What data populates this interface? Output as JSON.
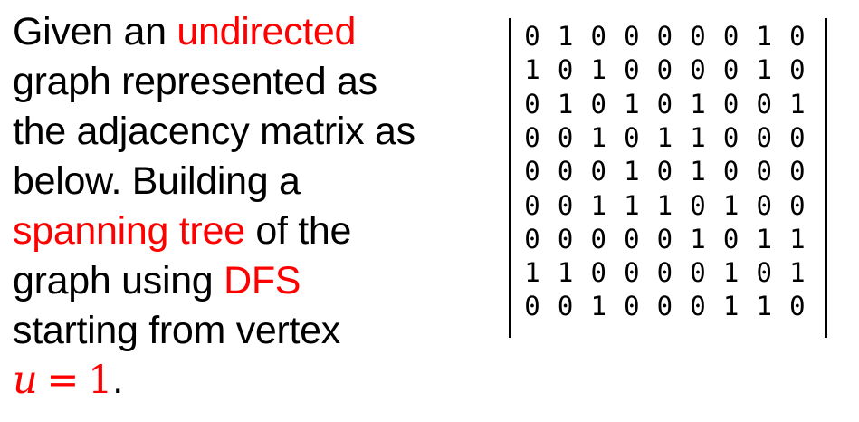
{
  "prose": {
    "l1_pre": "Given an ",
    "l1_red": "undirected",
    "l2": "graph represented as",
    "l3": "the adjacency matrix as",
    "l4": "below. Building a",
    "l5_red": "spanning tree",
    "l5_post": " of the",
    "l6_pre": "graph using ",
    "l6_red": "DFS",
    "l7": "starting from vertex",
    "math_var": "u",
    "math_eq": "=",
    "math_val": "1",
    "math_period": "."
  },
  "colors": {
    "text": "#000000",
    "highlight": "#ff0000",
    "background": "#ffffff"
  },
  "matrix": [
    [
      0,
      1,
      0,
      0,
      0,
      0,
      0,
      1,
      0
    ],
    [
      1,
      0,
      1,
      0,
      0,
      0,
      0,
      1,
      0
    ],
    [
      0,
      1,
      0,
      1,
      0,
      1,
      0,
      0,
      1
    ],
    [
      0,
      0,
      1,
      0,
      1,
      1,
      0,
      0,
      0
    ],
    [
      0,
      0,
      0,
      1,
      0,
      1,
      0,
      0,
      0
    ],
    [
      0,
      0,
      1,
      1,
      1,
      0,
      1,
      0,
      0
    ],
    [
      0,
      0,
      0,
      0,
      0,
      1,
      0,
      1,
      1
    ],
    [
      1,
      1,
      0,
      0,
      0,
      0,
      1,
      0,
      1
    ],
    [
      0,
      0,
      1,
      0,
      0,
      0,
      1,
      1,
      0
    ]
  ]
}
